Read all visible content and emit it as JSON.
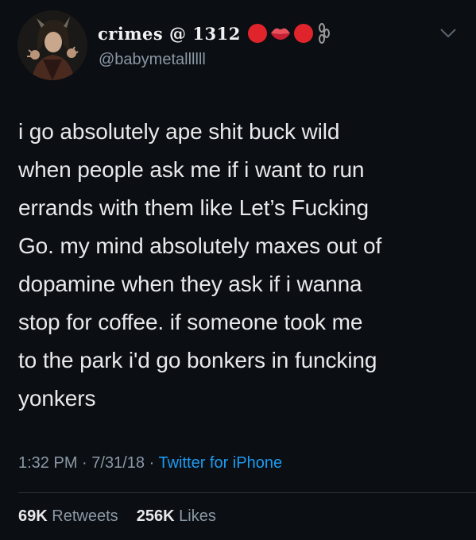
{
  "tweet": {
    "author": {
      "display_name": "crimes @ 1312",
      "handle": "@babymetallllll",
      "avatar": "avatar",
      "name_emojis": [
        "red-circle-icon",
        "lips-icon",
        "red-circle-icon",
        "chain-link-icon"
      ]
    },
    "menu_icon": "chevron-down-icon",
    "text_lines": [
      "i go absolutely ape shit buck wild",
      "when people ask me if i want to run",
      "errands with them like Let’s Fucking",
      "Go. my mind absolutely maxes out of",
      "dopamine when they ask if i wanna",
      "stop for coffee. if someone took me",
      "to the park i'd go bonkers in funcking",
      "yonkers"
    ],
    "meta": {
      "time": "1:32 PM",
      "separator": "·",
      "date": "7/31/18",
      "source": "Twitter for iPhone"
    },
    "stats": {
      "retweets_count": "69K",
      "retweets_label": "Retweets",
      "likes_count": "256K",
      "likes_label": "Likes"
    },
    "colors": {
      "background": "#0b0e13",
      "text": "#e7e9ea",
      "secondary": "#8b98a5",
      "link": "#1d9bf0",
      "emoji_red": "#e0242c"
    }
  }
}
